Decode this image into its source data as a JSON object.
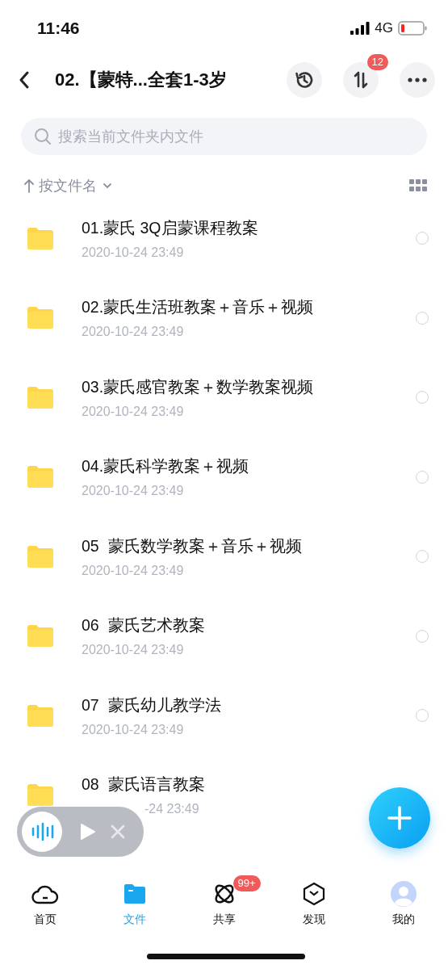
{
  "status_bar": {
    "time": "11:46",
    "network": "4G"
  },
  "header": {
    "title": "02.【蒙特...全套1-3岁",
    "transfer_badge": "12"
  },
  "search": {
    "placeholder": "搜索当前文件夹内文件"
  },
  "sort": {
    "label": "按文件名"
  },
  "files": [
    {
      "name": "01.蒙氏 3Q启蒙课程教案",
      "date": "2020-10-24 23:49",
      "selected": false
    },
    {
      "name": "02.蒙氏生活班教案＋音乐＋视频",
      "date": "2020-10-24 23:49",
      "selected": false
    },
    {
      "name": "03.蒙氏感官教案＋数学教案视频",
      "date": "2020-10-24 23:49",
      "selected": false
    },
    {
      "name": "04.蒙氏科学教案＋视频",
      "date": "2020-10-24 23:49",
      "selected": false
    },
    {
      "name": "05  蒙氏数学教案＋音乐＋视频",
      "date": "2020-10-24 23:49",
      "selected": false
    },
    {
      "name": "06  蒙氏艺术教案",
      "date": "2020-10-24 23:49",
      "selected": false
    },
    {
      "name": "07  蒙氏幼儿教学法",
      "date": "2020-10-24 23:49",
      "selected": false
    },
    {
      "name": "08  蒙氏语言教案",
      "date": "-24 23:49"
    }
  ],
  "tabs": [
    {
      "kind": "home",
      "label": "首页",
      "selected": false
    },
    {
      "kind": "files",
      "label": "文件",
      "selected": true
    },
    {
      "kind": "share",
      "label": "共享",
      "selected": false,
      "badge": "99+"
    },
    {
      "kind": "discover",
      "label": "发现",
      "selected": false
    },
    {
      "kind": "me",
      "label": "我的",
      "selected": false
    }
  ]
}
